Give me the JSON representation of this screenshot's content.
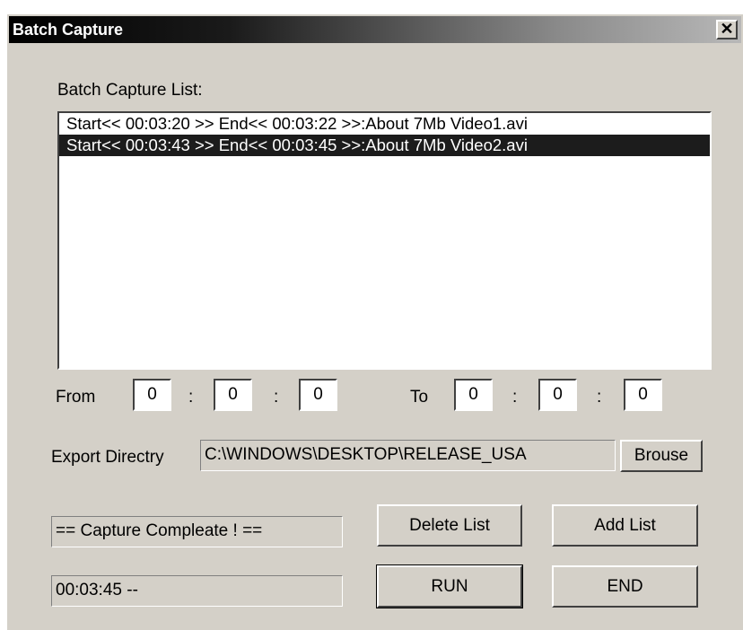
{
  "window": {
    "title": "Batch Capture",
    "close_glyph": "✕"
  },
  "list_label": "Batch Capture List:",
  "list_items": [
    "Start<< 00:03:20 >> End<< 00:03:22 >>:About   7Mb Video1.avi",
    "Start<< 00:03:43 >> End<< 00:03:45 >>:About   7Mb Video2.avi"
  ],
  "time_range": {
    "from_label": "From",
    "to_label": "To",
    "separator": ":",
    "from": [
      "0",
      "0",
      "0"
    ],
    "to": [
      "0",
      "0",
      "0"
    ]
  },
  "export": {
    "label": "Export Directry",
    "path": "C:\\WINDOWS\\DESKTOP\\RELEASE_USA",
    "browse_label": "Brouse"
  },
  "status": {
    "message": "== Capture Compleate ! ==",
    "time": "00:03:45 --"
  },
  "buttons": {
    "delete_list": "Delete List",
    "add_list": "Add List",
    "run": "RUN",
    "end": "END"
  }
}
